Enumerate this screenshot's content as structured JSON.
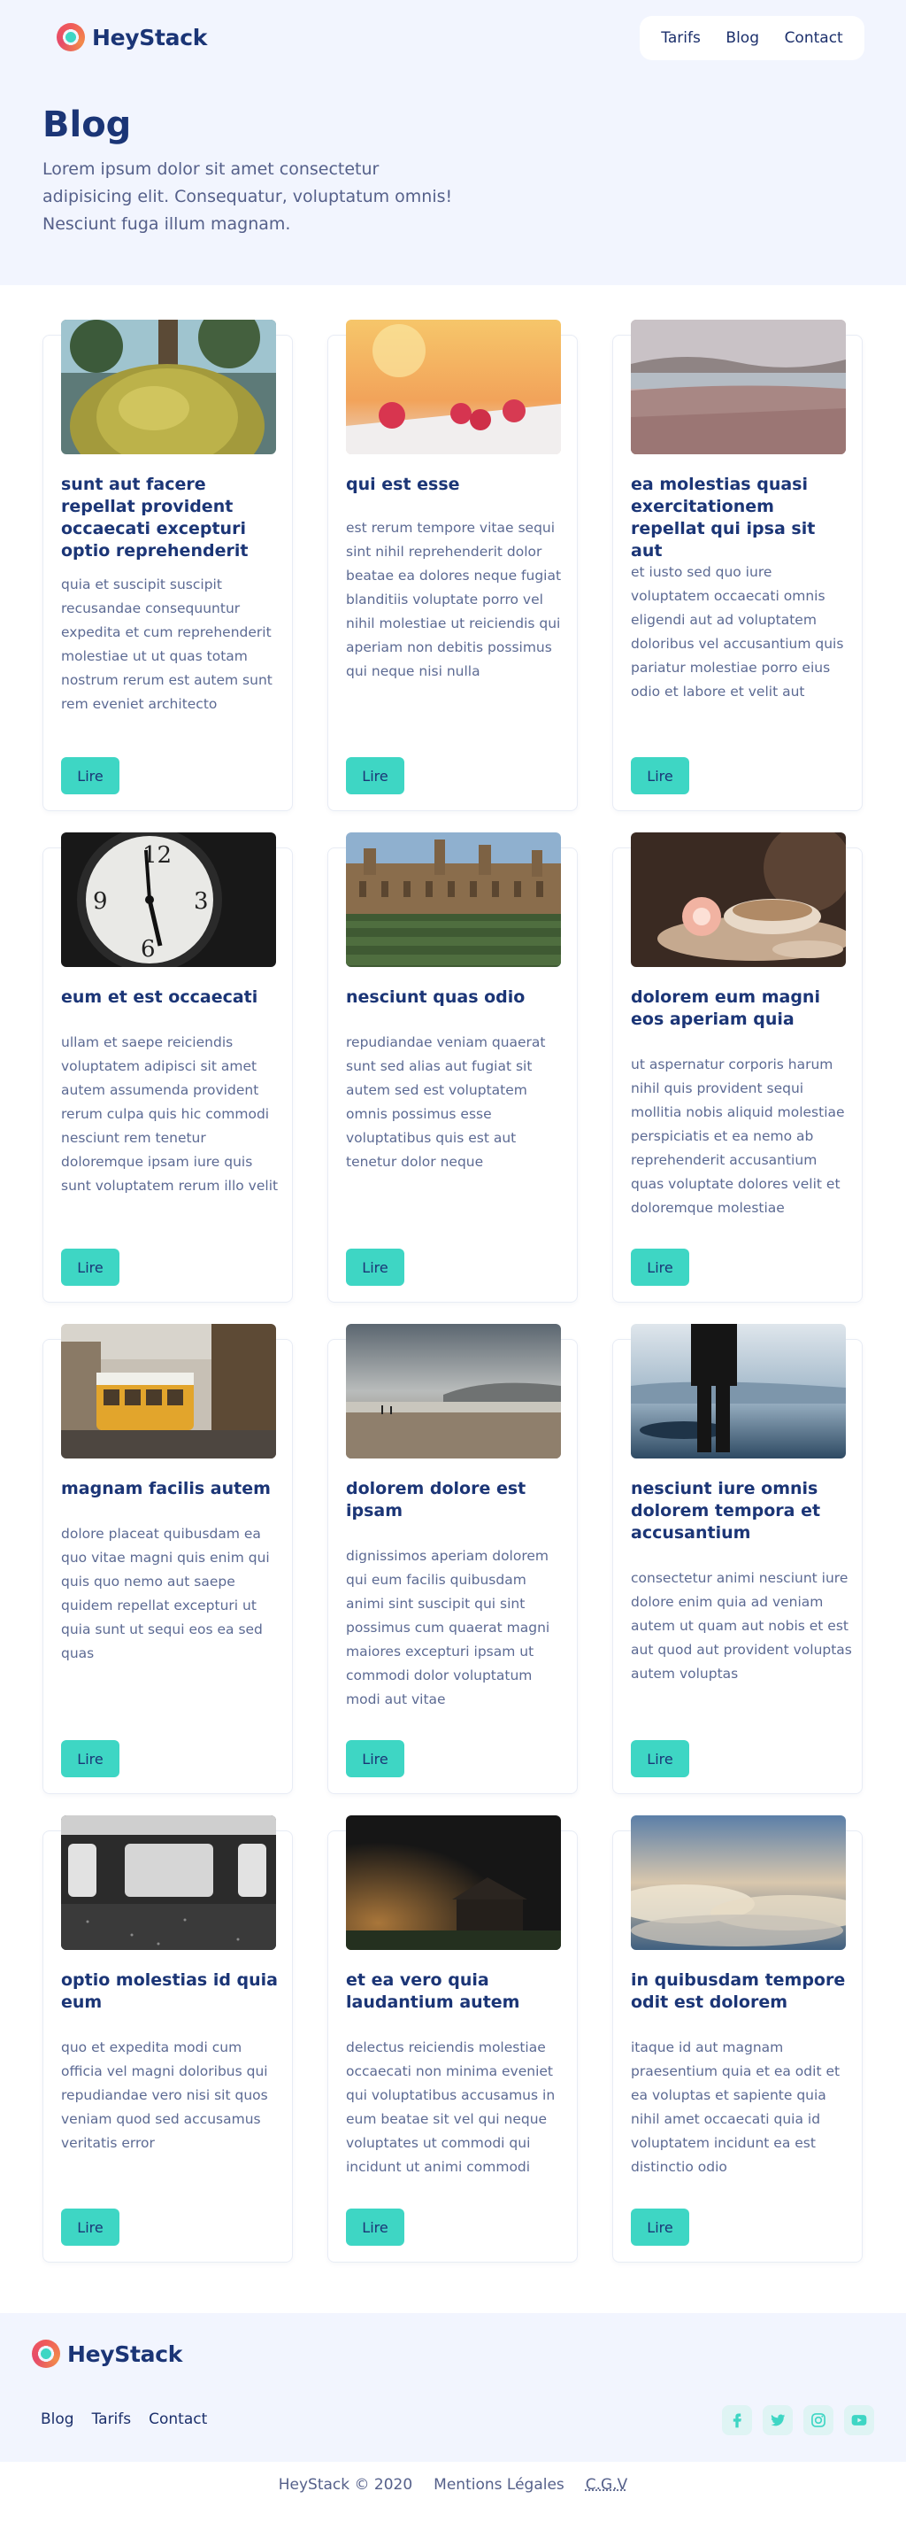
{
  "brand": {
    "name": "HeyStack"
  },
  "nav": {
    "items": [
      "Tarifs",
      "Blog",
      "Contact"
    ]
  },
  "page": {
    "title": "Blog",
    "intro": "Lorem ipsum dolor sit amet consectetur adipisicing elit. Consequatur, voluptatum omnis! Nesciunt fuga illum magnam."
  },
  "button_label": "Lire",
  "cards": [
    {
      "title": "sunt aut facere repellat provident occaecati excepturi optio reprehenderit",
      "text": "quia et suscipit suscipit recusandae consequuntur expedita et cum reprehenderit molestiae ut ut quas totam nostrum rerum est autem sunt rem eveniet architecto",
      "image": "moss-tree-photo"
    },
    {
      "title": "qui est esse",
      "text": "est rerum tempore vitae sequi sint nihil reprehenderit dolor beatae ea dolores neque fugiat blanditiis voluptate porro vel nihil molestiae ut reiciendis qui aperiam non debitis possimus qui neque nisi nulla",
      "image": "raspberries-photo"
    },
    {
      "title": "ea molestias quasi exercitationem repellat qui ipsa sit aut",
      "text": "et iusto sed quo iure voluptatem occaecati omnis eligendi aut ad voluptatem doloribus vel accusantium quis pariatur molestiae porro eius odio et labore et velit aut",
      "image": "lake-field-photo"
    },
    {
      "title": "eum et est occaecati",
      "text": "ullam et saepe reiciendis voluptatem adipisci sit amet autem assumenda provident rerum culpa quis hic commodi nesciunt rem tenetur doloremque ipsam iure quis sunt voluptatem rerum illo velit",
      "image": "clock-photo"
    },
    {
      "title": "nesciunt quas odio",
      "text": "repudiandae veniam quaerat sunt sed alias aut fugiat sit autem sed est voluptatem omnis possimus esse voluptatibus quis est aut tenetur dolor neque",
      "image": "college-photo"
    },
    {
      "title": "dolorem eum magni eos aperiam quia",
      "text": "ut aspernatur corporis harum nihil quis provident sequi mollitia nobis aliquid molestiae perspiciatis et ea nemo ab reprehenderit accusantium quas voluptate dolores velit et doloremque molestiae",
      "image": "teacup-photo"
    },
    {
      "title": "magnam facilis autem",
      "text": "dolore placeat quibusdam ea quo vitae magni quis enim qui quis quo nemo aut saepe quidem repellat excepturi ut quia sunt ut sequi eos ea sed quas",
      "image": "tram-photo"
    },
    {
      "title": "dolorem dolore est ipsam",
      "text": "dignissimos aperiam dolorem qui eum facilis quibusdam animi sint suscipit qui sint possimus cum quaerat magni maiores excepturi ipsam ut commodi dolor voluptatum modi aut vitae",
      "image": "beach-photo"
    },
    {
      "title": "nesciunt iure omnis dolorem tempora et accusantium",
      "text": "consectetur animi nesciunt iure dolore enim quia ad veniam autem ut quam aut nobis et est aut quod aut provident voluptas autem voluptas",
      "image": "silhouette-lake-photo"
    },
    {
      "title": "optio molestias id quia eum",
      "text": "quo et expedita modi cum officia vel magni doloribus qui repudiandae vero nisi sit quos veniam quod sed accusamus veritatis error",
      "image": "train-window-photo"
    },
    {
      "title": "et ea vero quia laudantium autem",
      "text": "delectus reiciendis molestiae occaecati non minima eveniet qui voluptatibus accusamus in eum beatae sit vel qui neque voluptates ut commodi qui incidunt ut animi commodi",
      "image": "night-barn-photo"
    },
    {
      "title": "in quibusdam tempore odit est dolorem",
      "text": "itaque id aut magnam praesentium quia et ea odit et ea voluptas et sapiente quia nihil amet occaecati quia id voluptatem incidunt ea est distinctio odio",
      "image": "clouds-photo"
    }
  ],
  "footer": {
    "links": [
      "Blog",
      "Tarifs",
      "Contact"
    ],
    "socials": [
      "facebook-icon",
      "twitter-icon",
      "instagram-icon",
      "youtube-icon"
    ],
    "copyright": "HeyStack © 2020",
    "legal": "Mentions Légales",
    "cgv": "C.G.V"
  }
}
